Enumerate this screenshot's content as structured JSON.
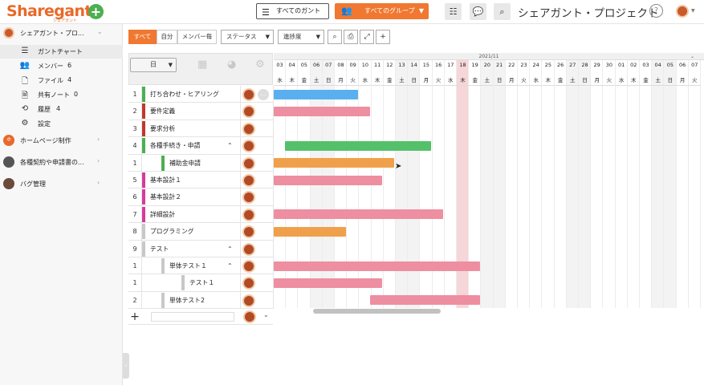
{
  "header": {
    "logo_text": "Sharegantt",
    "logo_sub": "シェアガント",
    "all_gantt_label": "すべてのガント",
    "all_groups_label": "すべてのグループ",
    "project_title": "シェアガント・プロジェクト",
    "help_label": "?"
  },
  "sidebar": {
    "projects": [
      {
        "name": "シェアガント・プロ...",
        "avatar_color": "#c95a2a"
      },
      {
        "name": "ホームページ制作",
        "avatar_color": "#e8692a",
        "avatar_text": "ホ"
      },
      {
        "name": "各種契約や申請書の...",
        "avatar_color": "#555555"
      },
      {
        "name": "バグ管理",
        "avatar_color": "#6a4a3a"
      }
    ],
    "items": [
      {
        "label": "ガントチャート",
        "icon": "gantt-icon",
        "count": ""
      },
      {
        "label": "メンバー",
        "icon": "members-icon",
        "count": "6"
      },
      {
        "label": "ファイル",
        "icon": "file-icon",
        "count": "4"
      },
      {
        "label": "共有ノート",
        "icon": "note-icon",
        "count": "0"
      },
      {
        "label": "履歴",
        "icon": "history-icon",
        "count": "4"
      },
      {
        "label": "設定",
        "icon": "settings-icon",
        "count": ""
      }
    ]
  },
  "filters": {
    "all": "すべて",
    "mine": "自分",
    "per_member": "メンバー毎",
    "status": "ステータス",
    "progress": "進捗度"
  },
  "day_select": "日",
  "tasks": [
    {
      "num": "1",
      "name": "打ち合わせ・ヒアリング",
      "color": "#4caf50",
      "level": 0,
      "expand": ""
    },
    {
      "num": "2",
      "name": "要件定義",
      "color": "#c0392b",
      "level": 0,
      "expand": ""
    },
    {
      "num": "3",
      "name": "要求分析",
      "color": "#c0392b",
      "level": 0,
      "expand": ""
    },
    {
      "num": "4",
      "name": "各種手続き・申請",
      "color": "#4caf50",
      "level": 0,
      "expand": "^"
    },
    {
      "num": "1",
      "name": "補助金申請",
      "color": "#4caf50",
      "level": 1,
      "expand": ""
    },
    {
      "num": "5",
      "name": "基本設計１",
      "color": "#d63a9e",
      "level": 0,
      "expand": ""
    },
    {
      "num": "6",
      "name": "基本設計２",
      "color": "#d63a9e",
      "level": 0,
      "expand": ""
    },
    {
      "num": "7",
      "name": "詳細設計",
      "color": "#d63a9e",
      "level": 0,
      "expand": ""
    },
    {
      "num": "8",
      "name": "プログラミング",
      "color": "#c8c8c8",
      "level": 0,
      "expand": ""
    },
    {
      "num": "9",
      "name": "テスト",
      "color": "#c8c8c8",
      "level": 0,
      "expand": "^"
    },
    {
      "num": "1",
      "name": "単体テスト１",
      "color": "#c8c8c8",
      "level": 1,
      "expand": "^"
    },
    {
      "num": "1",
      "name": "テスト１",
      "color": "#c8c8c8",
      "level": 2,
      "expand": ""
    },
    {
      "num": "2",
      "name": "単体テスト2",
      "color": "#c8c8c8",
      "level": 1,
      "expand": ""
    }
  ],
  "gantt": {
    "month_label": "2021/11",
    "days": [
      "03",
      "04",
      "05",
      "06",
      "07",
      "08",
      "09",
      "10",
      "11",
      "12",
      "13",
      "14",
      "15",
      "16",
      "17",
      "18",
      "19",
      "20",
      "21",
      "22",
      "23",
      "24",
      "25",
      "26",
      "27",
      "28",
      "29",
      "30",
      "01",
      "02",
      "03",
      "04",
      "05",
      "06",
      "07"
    ],
    "weekdays": [
      "水",
      "木",
      "金",
      "土",
      "日",
      "月",
      "火",
      "水",
      "木",
      "金",
      "土",
      "日",
      "月",
      "火",
      "水",
      "木",
      "金",
      "土",
      "日",
      "月",
      "火",
      "水",
      "木",
      "金",
      "土",
      "日",
      "月",
      "火",
      "水",
      "木",
      "金",
      "土",
      "日",
      "月",
      "火"
    ],
    "weekend_indices": [
      3,
      4,
      10,
      11,
      17,
      18,
      24,
      25,
      31,
      32
    ],
    "today_index": 15,
    "bars": [
      {
        "row": 0,
        "start": 0,
        "end": 6.9,
        "color": "#5aaff0"
      },
      {
        "row": 1,
        "start": 0,
        "end": 7.9,
        "color": "#ee8ea1"
      },
      {
        "row": 3,
        "start": 0.9,
        "end": 12.9,
        "color": "#55c06a"
      },
      {
        "row": 4,
        "start": 0,
        "end": 9.9,
        "color": "#f0a04a"
      },
      {
        "row": 5,
        "start": 0,
        "end": 8.9,
        "color": "#ee8ea1"
      },
      {
        "row": 7,
        "start": 0,
        "end": 13.9,
        "color": "#ee8ea1"
      },
      {
        "row": 8,
        "start": 0,
        "end": 5.9,
        "color": "#f0a04a"
      },
      {
        "row": 10,
        "start": 0,
        "end": 16.9,
        "color": "#ee8ea1"
      },
      {
        "row": 11,
        "start": 0,
        "end": 8.9,
        "color": "#ee8ea1"
      },
      {
        "row": 12,
        "start": 7.9,
        "end": 16.9,
        "color": "#ee8ea1"
      }
    ]
  }
}
